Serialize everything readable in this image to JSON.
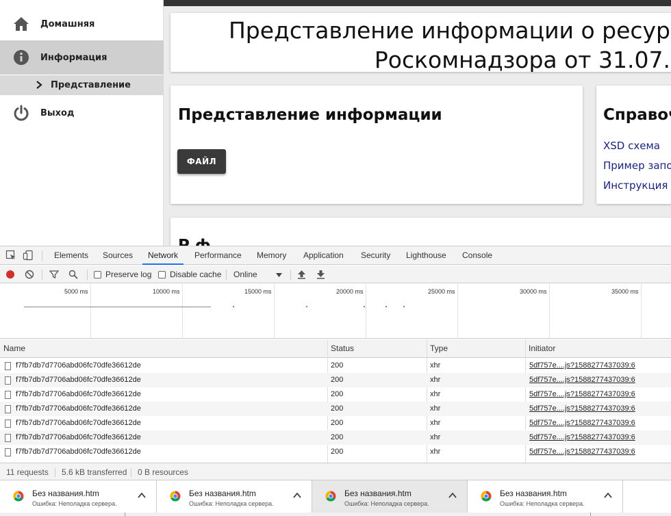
{
  "sidebar": {
    "items": [
      {
        "label": "Домашняя",
        "icon": "home-icon"
      },
      {
        "label": "Информация",
        "icon": "info-icon"
      },
      {
        "label": "Представление",
        "icon": "chevron-right-icon"
      },
      {
        "label": "Выход",
        "icon": "power-icon"
      }
    ]
  },
  "main": {
    "title_line1": "Представление информации о ресур",
    "title_line2": "Роскомнадзора от 31.07.",
    "info_card": {
      "heading": "Представление информации",
      "button": "ФАЙЛ"
    },
    "ref_card": {
      "heading": "Справоч",
      "links": [
        "XSD схема",
        "Пример запо",
        "Инструкция п"
      ]
    },
    "bottom_heading": "Р                          ф"
  },
  "devtools": {
    "tabs": [
      "Elements",
      "Sources",
      "Network",
      "Performance",
      "Memory",
      "Application",
      "Security",
      "Lighthouse",
      "Console"
    ],
    "active_tab": "Network",
    "toolbar": {
      "preserve_log": "Preserve log",
      "disable_cache": "Disable cache",
      "throttle": "Online"
    },
    "timeline_ticks": [
      "5000 ms",
      "10000 ms",
      "15000 ms",
      "20000 ms",
      "25000 ms",
      "30000 ms",
      "35000 ms"
    ],
    "columns": [
      "Name",
      "Status",
      "Type",
      "Initiator"
    ],
    "rows": [
      {
        "name": "f7fb7db7d7706abd06fc70dfe36612de",
        "status": "200",
        "type": "xhr",
        "initiator": "5df757e....js?1588277437039:6"
      },
      {
        "name": "f7fb7db7d7706abd06fc70dfe36612de",
        "status": "200",
        "type": "xhr",
        "initiator": "5df757e....js?1588277437039:6"
      },
      {
        "name": "f7fb7db7d7706abd06fc70dfe36612de",
        "status": "200",
        "type": "xhr",
        "initiator": "5df757e....js?1588277437039:6"
      },
      {
        "name": "f7fb7db7d7706abd06fc70dfe36612de",
        "status": "200",
        "type": "xhr",
        "initiator": "5df757e....js?1588277437039:6"
      },
      {
        "name": "f7fb7db7d7706abd06fc70dfe36612de",
        "status": "200",
        "type": "xhr",
        "initiator": "5df757e....js?1588277437039:6"
      },
      {
        "name": "f7fb7db7d7706abd06fc70dfe36612de",
        "status": "200",
        "type": "xhr",
        "initiator": "5df757e....js?1588277437039:6"
      },
      {
        "name": "f7fb7db7d7706abd06fc70dfe36612de",
        "status": "200",
        "type": "xhr",
        "initiator": "5df757e....js?1588277437039:6"
      }
    ],
    "status_bar": {
      "requests": "11 requests",
      "transferred": "5.6 kB transferred",
      "resources": "0 B resources"
    }
  },
  "downloads": [
    {
      "name": "Без названия.htm",
      "status": "Ошибка: Неполадка сервера."
    },
    {
      "name": "Без названия.htm",
      "status": "Ошибка: Неполадка сервера."
    },
    {
      "name": "Без названия.htm",
      "status": "Ошибка: Неполадка сервера."
    },
    {
      "name": "Без названия.htm",
      "status": "Ошибка: Неполадка сервера."
    }
  ],
  "colors": {
    "accent": "#1a73e8",
    "button_dark": "#3a3a3a",
    "link": "#1a237e",
    "record_red": "#d32f2f"
  }
}
